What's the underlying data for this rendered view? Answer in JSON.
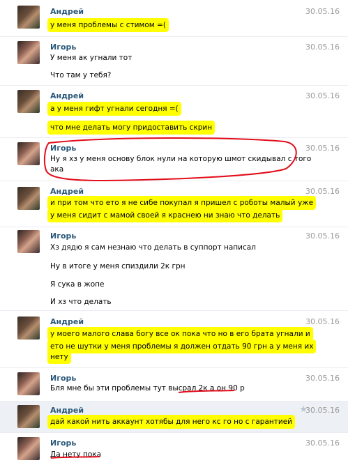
{
  "messages": [
    {
      "sender": "Андрей",
      "date": "30.05.16",
      "lines": [
        "у меня проблемы с стимом =("
      ]
    },
    {
      "sender": "Игорь",
      "date": "30.05.16",
      "lines": [
        "У меня ак угнали тот",
        "Что там у тебя?"
      ]
    },
    {
      "sender": "Андрей",
      "date": "30.05.16",
      "lines": [
        "а у меня гифт угнали сегодня =(",
        "что мне делать могу придоставить скрин"
      ]
    },
    {
      "sender": "Игорь",
      "date": "30.05.16",
      "lines": [
        "Ну я хз у меня основу блок нули на которую шмот скидывал с того",
        "ака"
      ]
    },
    {
      "sender": "Андрей",
      "date": "30.05.16",
      "lines": [
        "и при том что ето я не сибе покупал я пришел с роботы малый уже",
        "у меня сидит с мамой своей я краснею ни знаю что делать"
      ]
    },
    {
      "sender": "Игорь",
      "date": "30.05.16",
      "lines": [
        "Хз дядю я сам незнаю что делать в суппорт написал",
        "Ну в итоге у меня спиздили 2к грн",
        "Я сука в жопе",
        "И хз что делать"
      ]
    },
    {
      "sender": "Андрей",
      "date": "30.05.16",
      "lines": [
        "у моего малого слава богу все ок пока что но в его брата угнали и",
        "ето не шутки у меня проблемы я должен отдать 90 грн а у меня их",
        "нету"
      ]
    },
    {
      "sender": "Игорь",
      "date": "30.05.16",
      "lines": [
        "Бля мне бы эти проблемы тут высрал 2к а он 90 р"
      ]
    },
    {
      "sender": "Андрей",
      "date": "30.05.16",
      "lines": [
        "дай какой нить аккаунт хотябы для него кс го но с гарантией"
      ]
    },
    {
      "sender": "Игорь",
      "date": "30.05.16",
      "lines": [
        "Да нету пока"
      ]
    }
  ]
}
